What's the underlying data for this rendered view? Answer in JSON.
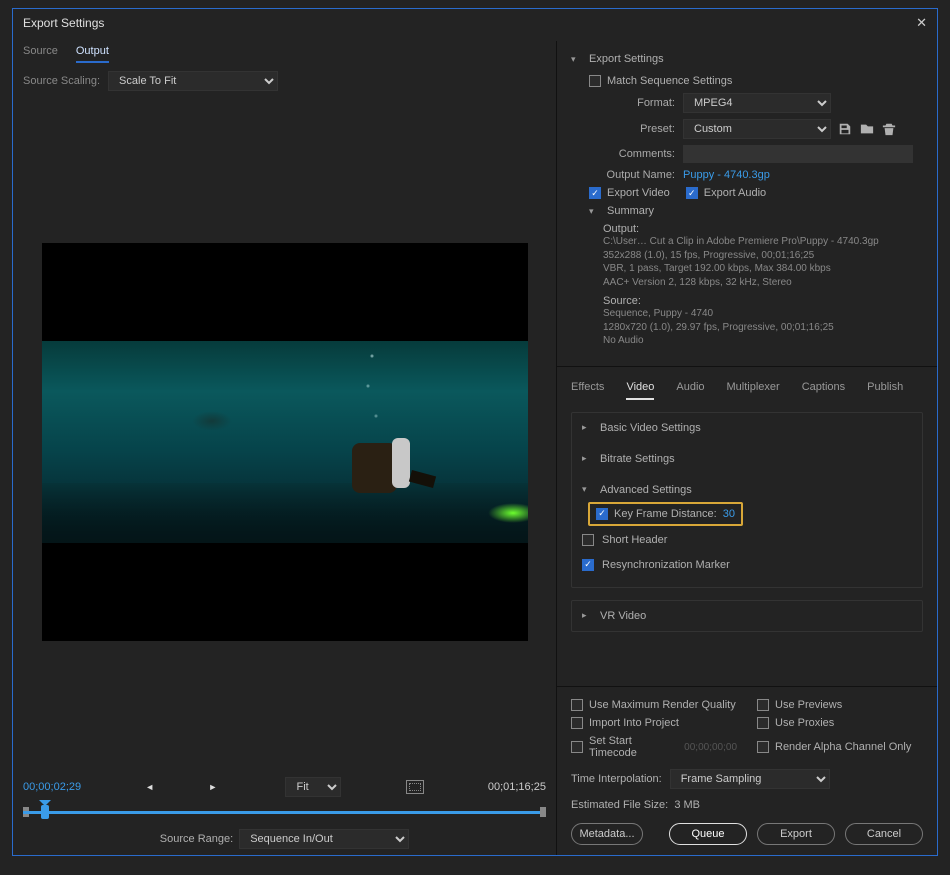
{
  "dialog": {
    "title": "Export Settings",
    "close": "✕"
  },
  "leftTabs": {
    "source": "Source",
    "output": "Output"
  },
  "sourceScaling": {
    "label": "Source Scaling:",
    "value": "Scale To Fit"
  },
  "transport": {
    "in": "00;00;02;29",
    "out": "00;01;16;25",
    "fit": "Fit",
    "sourceRangeLabel": "Source Range:",
    "sourceRangeValue": "Sequence In/Out"
  },
  "export": {
    "heading": "Export Settings",
    "matchSequence": "Match Sequence Settings",
    "formatLabel": "Format:",
    "formatValue": "MPEG4",
    "presetLabel": "Preset:",
    "presetValue": "Custom",
    "commentsLabel": "Comments:",
    "outputNameLabel": "Output Name:",
    "outputName": "Puppy - 4740.3gp",
    "exportVideo": "Export Video",
    "exportAudio": "Export Audio",
    "summaryLabel": "Summary",
    "summary": {
      "outputLabel": "Output:",
      "outputLines": "C:\\User… Cut a Clip in Adobe Premiere Pro\\Puppy - 4740.3gp\n352x288 (1.0), 15 fps, Progressive, 00;01;16;25\nVBR, 1 pass, Target 192.00 kbps, Max 384.00 kbps\nAAC+ Version 2, 128 kbps, 32 kHz, Stereo",
      "sourceLabel": "Source:",
      "sourceLines": "Sequence, Puppy - 4740\n1280x720 (1.0), 29.97 fps, Progressive, 00;01;16;25\nNo Audio"
    }
  },
  "tabs": {
    "effects": "Effects",
    "video": "Video",
    "audio": "Audio",
    "multiplexer": "Multiplexer",
    "captions": "Captions",
    "publish": "Publish"
  },
  "panels": {
    "basic": "Basic Video Settings",
    "bitrate": "Bitrate Settings",
    "advanced": "Advanced Settings",
    "keyFrameLabel": "Key Frame Distance:",
    "keyFrameValue": "30",
    "shortHeader": "Short Header",
    "resync": "Resynchronization Marker",
    "vr": "VR Video"
  },
  "footer": {
    "maxQuality": "Use Maximum Render Quality",
    "usePreviews": "Use Previews",
    "importProject": "Import Into Project",
    "useProxies": "Use Proxies",
    "setStart": "Set Start Timecode",
    "setStartValue": "00;00;00;00",
    "renderAlpha": "Render Alpha Channel Only",
    "timeInterpLabel": "Time Interpolation:",
    "timeInterpValue": "Frame Sampling",
    "estLabel": "Estimated File Size:",
    "estValue": "3 MB",
    "metadata": "Metadata...",
    "queue": "Queue",
    "export": "Export",
    "cancel": "Cancel"
  }
}
